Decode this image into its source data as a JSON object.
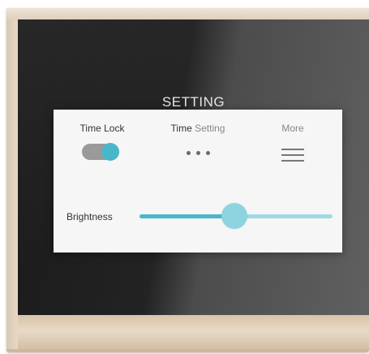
{
  "screen": {
    "title": "SETTING"
  },
  "settings": {
    "time_lock": {
      "label": "Time Lock",
      "enabled": true
    },
    "time_setting": {
      "label_bold": "Time",
      "label_rest": " Setting",
      "icon": "more-dots-icon"
    },
    "more": {
      "label": "More",
      "icon": "menu-icon"
    }
  },
  "brightness": {
    "label": "Brightness",
    "value_fraction": 0.49
  },
  "colors": {
    "accent": "#49b7c9",
    "accent_light": "#9fd9e3",
    "thumb": "#8ed4df"
  }
}
